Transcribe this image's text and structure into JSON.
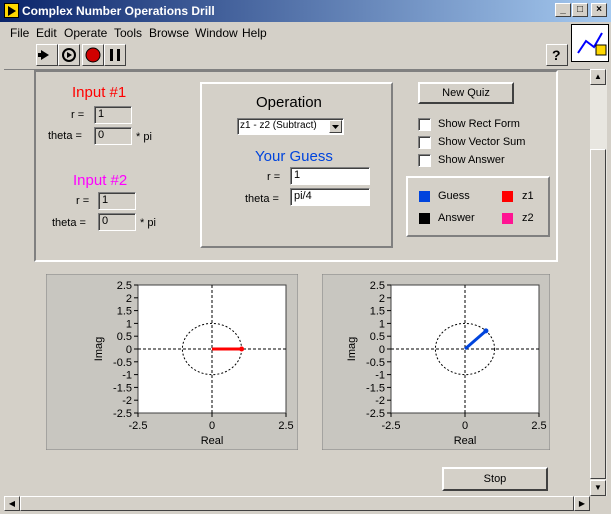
{
  "window": {
    "title": "Complex Number Operations Drill"
  },
  "menu": [
    "File",
    "Edit",
    "Operate",
    "Tools",
    "Browse",
    "Window",
    "Help"
  ],
  "input1": {
    "title": "Input #1",
    "r_label": "r =",
    "r_value": "1",
    "theta_label": "theta =",
    "theta_value": "0",
    "theta_unit": "* pi"
  },
  "input2": {
    "title": "Input #2",
    "r_label": "r =",
    "r_value": "1",
    "theta_label": "theta =",
    "theta_value": "0",
    "theta_unit": "* pi"
  },
  "operation": {
    "title": "Operation",
    "selected": "z1 - z2 (Subtract)"
  },
  "guess": {
    "title": "Your Guess",
    "r_label": "r =",
    "r_value": "1",
    "theta_label": "theta =",
    "theta_value": "pi/4"
  },
  "controls": {
    "new_quiz": "New Quiz",
    "show_rect": "Show Rect Form",
    "show_vector_sum": "Show Vector Sum",
    "show_answer": "Show Answer",
    "stop": "Stop"
  },
  "legend": {
    "guess": "Guess",
    "answer": "Answer",
    "z1": "z1",
    "z2": "z2",
    "colors": {
      "guess": "#0044dd",
      "answer": "#000000",
      "z1": "#ff0000",
      "z2": "#ff1493"
    }
  },
  "plots": {
    "xlabel": "Real",
    "ylabel": "Imag",
    "yticks": [
      "2.5",
      "2",
      "1.5",
      "1",
      "0.5",
      "0",
      "-0.5",
      "-1",
      "-1.5",
      "-2",
      "-2.5"
    ],
    "xticks": [
      "-2.5",
      "0",
      "2.5"
    ]
  },
  "chart_data": [
    {
      "type": "line",
      "xlabel": "Real",
      "ylabel": "Imag",
      "xlim": [
        -2.5,
        2.5
      ],
      "ylim": [
        -2.5,
        2.5
      ],
      "series": [
        {
          "name": "z1",
          "x": [
            0,
            1
          ],
          "y": [
            0,
            0
          ],
          "color": "#ff0000"
        }
      ],
      "unit_circle": true
    },
    {
      "type": "line",
      "xlabel": "Real",
      "ylabel": "Imag",
      "xlim": [
        -2.5,
        2.5
      ],
      "ylim": [
        -2.5,
        2.5
      ],
      "series": [
        {
          "name": "Guess",
          "x": [
            0,
            0.707
          ],
          "y": [
            0,
            0.707
          ],
          "color": "#0044dd"
        }
      ],
      "unit_circle": true
    }
  ]
}
